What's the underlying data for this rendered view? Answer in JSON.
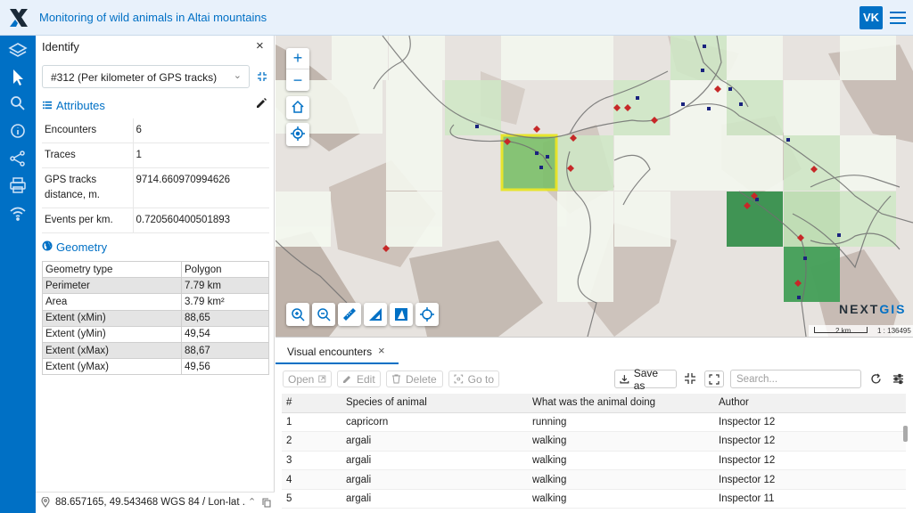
{
  "header": {
    "title": "Monitoring of wild animals in Altai mountains",
    "avatar_initials": "VK",
    "accent_color": "#0070c5"
  },
  "rail": {
    "items": [
      "layers-icon",
      "identify-cursor-icon",
      "search-icon",
      "info-icon",
      "share-icon",
      "print-icon",
      "wifi-icon"
    ]
  },
  "identify": {
    "title": "Identify",
    "selected_feature": "#312 (Per kilometer of GPS tracks)",
    "attributes_heading": "Attributes",
    "attributes": [
      {
        "name": "Encounters",
        "value": "6"
      },
      {
        "name": "Traces",
        "value": "1"
      },
      {
        "name": "GPS tracks distance, m.",
        "value": "9714.660970994626"
      },
      {
        "name": "Events per km.",
        "value": "0.720560400501893"
      }
    ],
    "geometry_heading": "Geometry",
    "geometry": [
      {
        "name": "Geometry type",
        "value": "Polygon"
      },
      {
        "name": "Perimeter",
        "value": "7.79 km"
      },
      {
        "name": "Area",
        "value": "3.79 km²"
      },
      {
        "name": "Extent (xMin)",
        "value": "88,65"
      },
      {
        "name": "Extent (yMin)",
        "value": "49,54"
      },
      {
        "name": "Extent (xMax)",
        "value": "88,67"
      },
      {
        "name": "Extent (yMax)",
        "value": "49,56"
      }
    ],
    "coordinates": "88.657165, 49.543468 WGS 84 / Lon-lat ..."
  },
  "map": {
    "zoom_in": "+",
    "zoom_out": "−",
    "logo_prefix": "NEXT",
    "logo_suffix": "GIS",
    "scale_distance": "2 km",
    "scale_ratio": "1 : 136495",
    "colors": {
      "selected_outline": "#e8e51a",
      "dark_cell": "#2e8b45",
      "light_cell": "#d7ecd0",
      "point_red": "#c62828",
      "point_blue": "#1a237e"
    }
  },
  "table_panel": {
    "tab_label": "Visual encounters",
    "buttons": {
      "open": "Open",
      "edit": "Edit",
      "delete": "Delete",
      "go_to": "Go to",
      "save_as": "Save as"
    },
    "search_placeholder": "Search...",
    "columns": [
      "#",
      "Species of animal",
      "What was the animal doing",
      "Author"
    ],
    "rows": [
      [
        "1",
        "capricorn",
        "running",
        "Inspector 12"
      ],
      [
        "2",
        "argali",
        "walking",
        "Inspector 12"
      ],
      [
        "3",
        "argali",
        "walking",
        "Inspector 12"
      ],
      [
        "4",
        "argali",
        "walking",
        "Inspector 12"
      ],
      [
        "5",
        "argali",
        "walking",
        "Inspector 11"
      ]
    ]
  }
}
